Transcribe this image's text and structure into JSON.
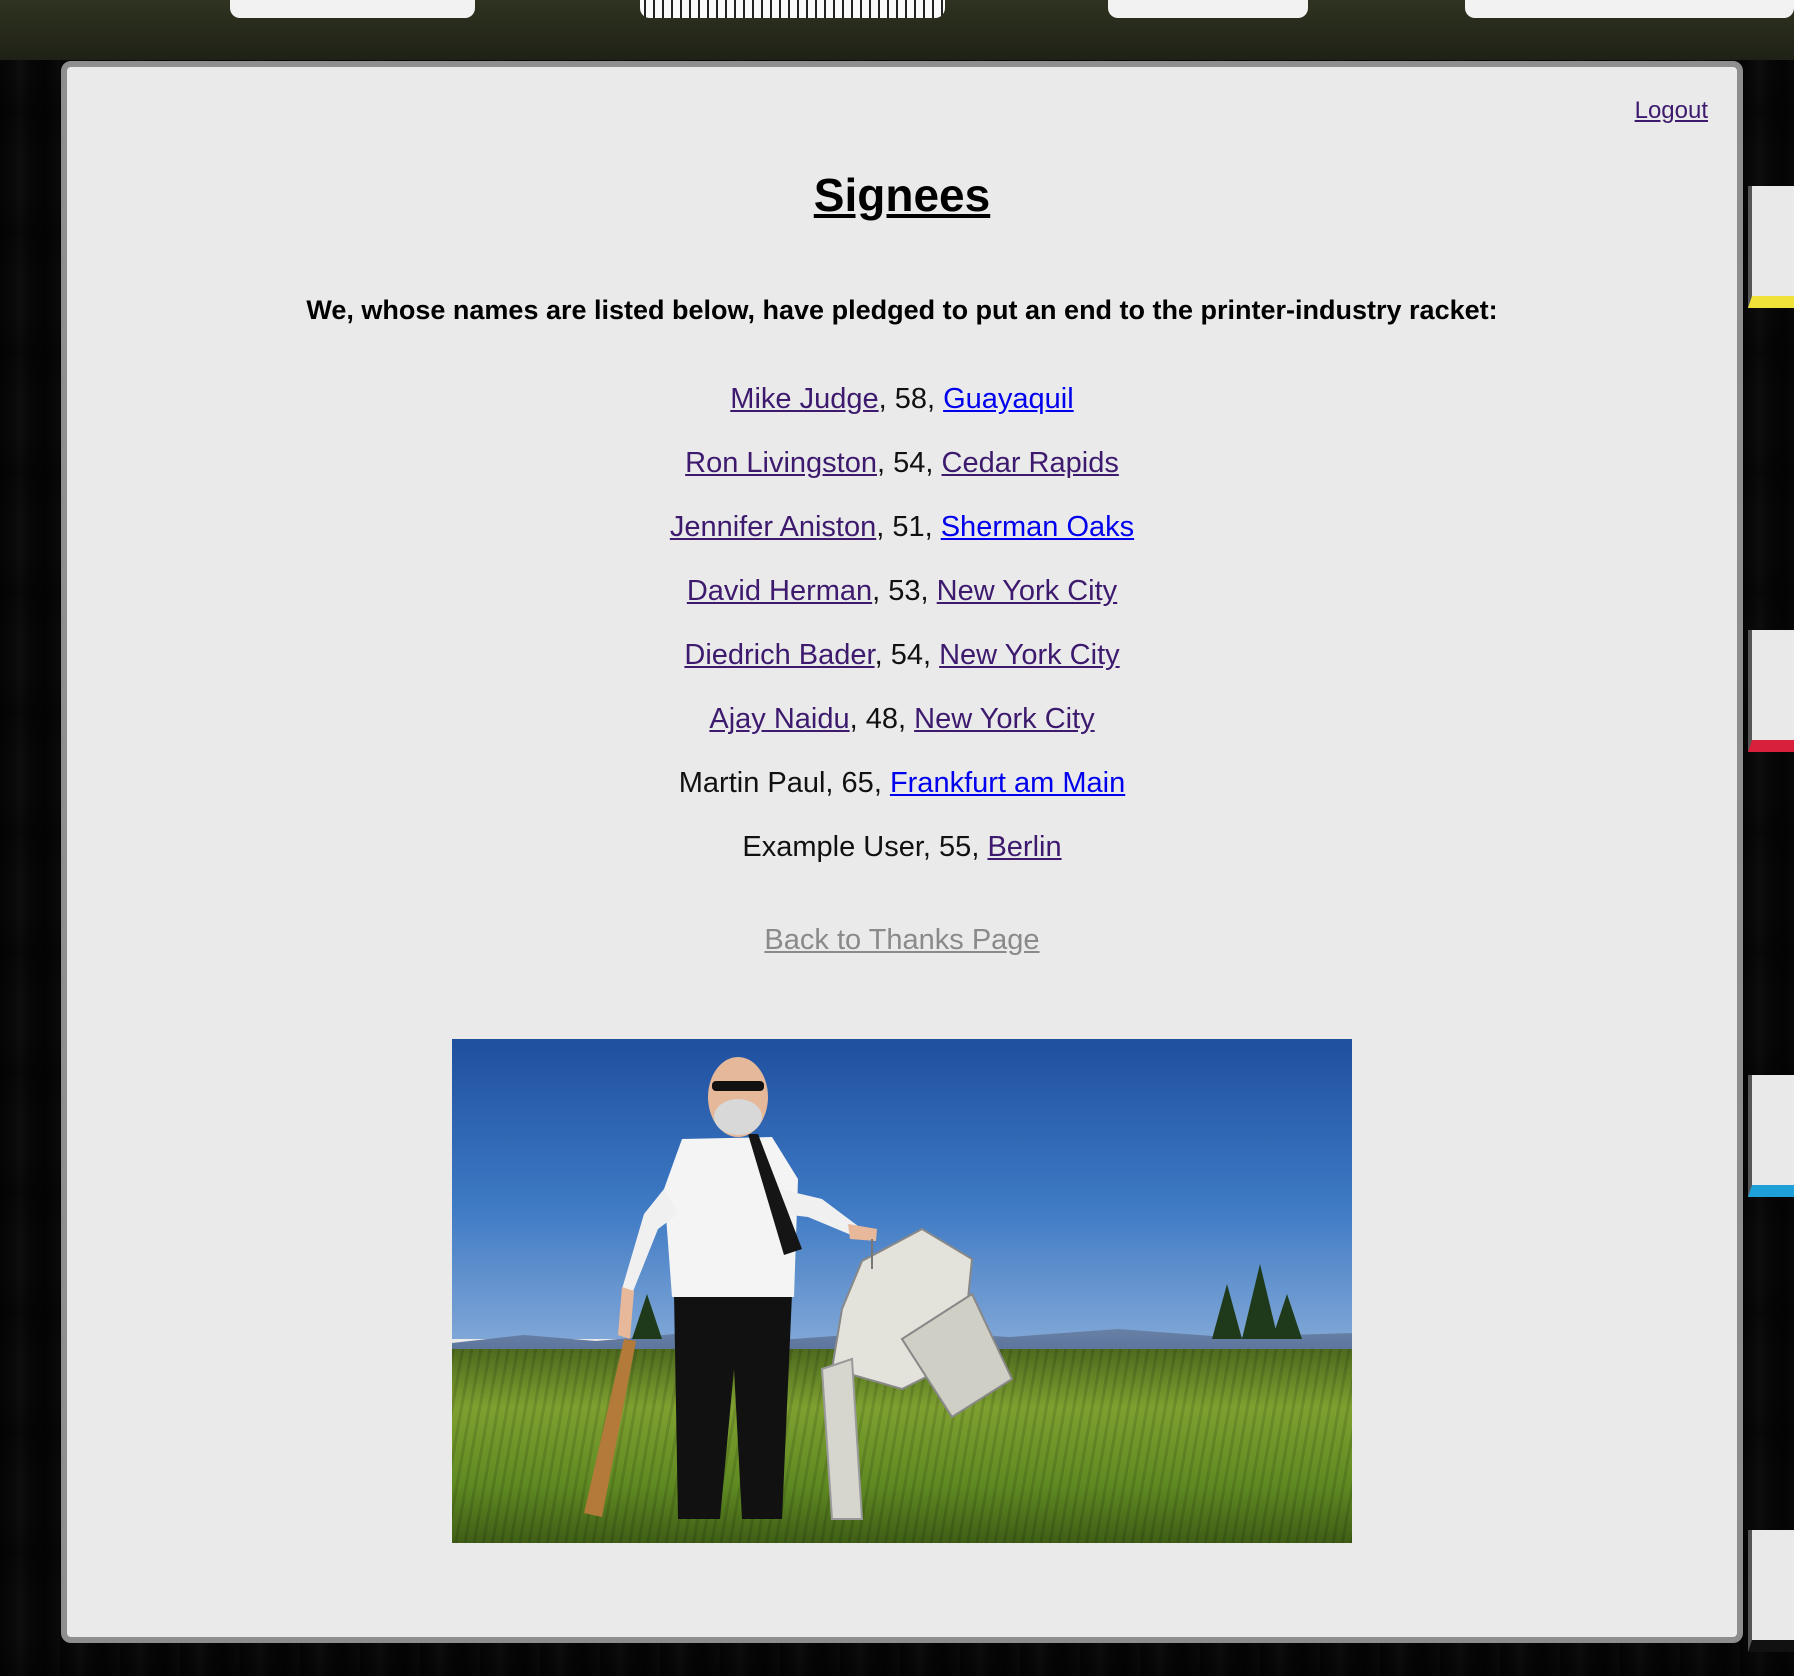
{
  "header": {
    "logout_label": "Logout"
  },
  "page": {
    "title": "Signees",
    "intro": "We, whose names are listed below, have pledged to put an end to the printer-industry racket:"
  },
  "signees": [
    {
      "name": "Mike Judge",
      "name_link": true,
      "age": "58",
      "city": "Guayaquil",
      "city_visited": false
    },
    {
      "name": "Ron Livingston",
      "name_link": true,
      "age": "54",
      "city": "Cedar Rapids",
      "city_visited": true
    },
    {
      "name": "Jennifer Aniston",
      "name_link": true,
      "age": "51",
      "city": "Sherman Oaks",
      "city_visited": false
    },
    {
      "name": "David Herman",
      "name_link": true,
      "age": "53",
      "city": "New York City",
      "city_visited": true
    },
    {
      "name": "Diedrich Bader",
      "name_link": true,
      "age": "54",
      "city": "New York City",
      "city_visited": true
    },
    {
      "name": "Ajay Naidu",
      "name_link": true,
      "age": "48",
      "city": "New York City",
      "city_visited": true
    },
    {
      "name": "Martin Paul",
      "name_link": false,
      "age": "65",
      "city": "Frankfurt am Main",
      "city_visited": false
    },
    {
      "name": "Example User",
      "name_link": false,
      "age": "55",
      "city": "Berlin",
      "city_visited": true
    }
  ],
  "footer": {
    "back_label": "Back to Thanks Page"
  },
  "colors": {
    "visited_link": "#3d1a6e",
    "unvisited_link": "#0000ee",
    "muted_link": "#8a8a8a",
    "panel_bg": "#f2f2f2"
  }
}
